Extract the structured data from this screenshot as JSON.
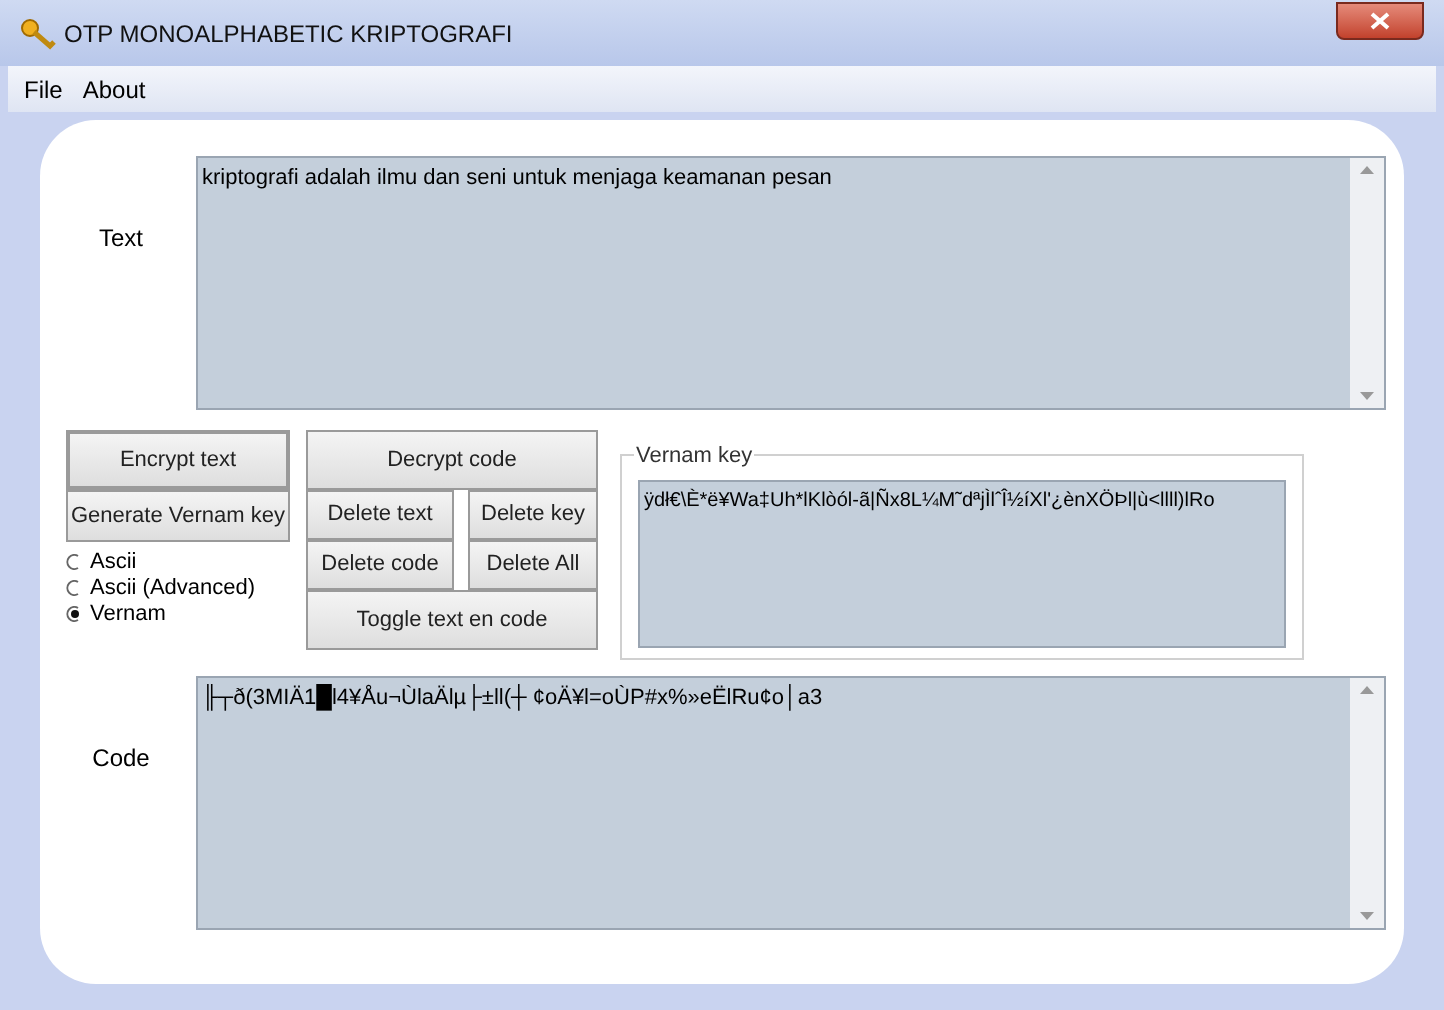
{
  "window": {
    "title": "OTP MONOALPHABETIC KRIPTOGRAFI"
  },
  "menu": [
    "File",
    "About"
  ],
  "text_field": {
    "label": "Text",
    "value": "kriptografi adalah ilmu dan seni untuk menjaga keamanan pesan"
  },
  "left_buttons": [
    "Encrypt text",
    "Generate Vernam key"
  ],
  "modes": [
    {
      "label": "Ascii",
      "selected": false
    },
    {
      "label": "Ascii (Advanced)",
      "selected": false
    },
    {
      "label": "Vernam",
      "selected": true
    }
  ],
  "decrypt_button": "Decrypt code",
  "delete_buttons": [
    "Delete text",
    "Delete key",
    "Delete code",
    "Delete All"
  ],
  "toggle_button": "Toggle text en code",
  "vernam_key": {
    "label": "Vernam key",
    "value": "ÿdł€\\È*ë¥Wa‡Uh*lKlòól-ã|Ñx8L¼M˜dªjÌlˆÎ½íXl'¿ènXÖÞl|ù<llll)lRo"
  },
  "code_field": {
    "label": "Code",
    "value": "╟┬ð(3MIÄ1█l4¥Åu¬ÙlaÄlµ├±ll(┼ ¢oÄ¥l=oÙP#x%»eËlRu¢o│a3"
  }
}
